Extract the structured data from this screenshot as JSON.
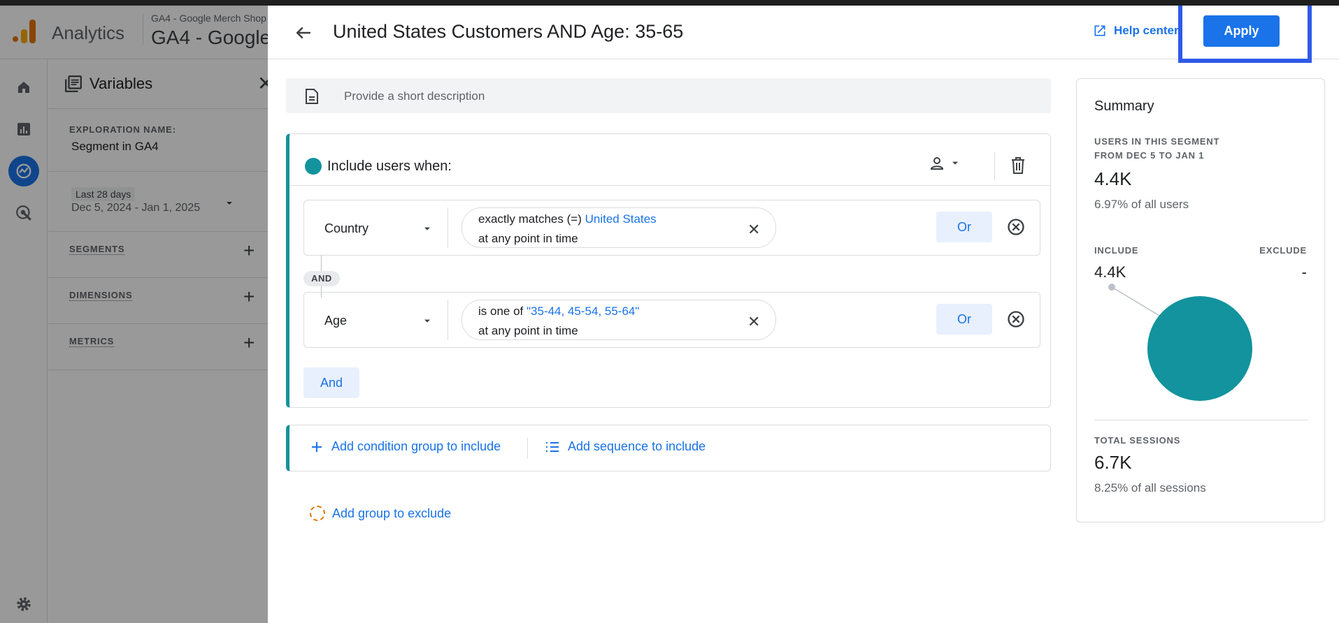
{
  "app": {
    "name": "Analytics",
    "property_small": "GA4 - Google Merch Shop",
    "property_big": "GA4 - Google"
  },
  "variables": {
    "title": "Variables",
    "exploration_label": "EXPLORATION NAME:",
    "exploration_value": "Segment in GA4",
    "date_chip": "Last 28 days",
    "date_range": "Dec 5, 2024 - Jan 1, 2025",
    "sections": [
      "SEGMENTS",
      "DIMENSIONS",
      "METRICS"
    ]
  },
  "editor": {
    "title": "United States Customers AND Age: 35-65",
    "help_label": "Help center",
    "apply_label": "Apply",
    "description_placeholder": "Provide a short description",
    "include_label": "Include users when:",
    "conditions": [
      {
        "dimension": "Country",
        "operator": "exactly matches (=)",
        "value": "United States",
        "time": "at any point in time",
        "or_label": "Or"
      },
      {
        "dimension": "Age",
        "operator": "is one of",
        "value": "\"35-44, 45-54, 55-64\"",
        "time": "at any point in time",
        "or_label": "Or"
      }
    ],
    "and_chip": "AND",
    "and_button": "And",
    "add_condition_group": "Add condition group to include",
    "add_sequence": "Add sequence to include",
    "add_exclude": "Add group to exclude"
  },
  "summary": {
    "title": "Summary",
    "users_label_1": "USERS IN THIS SEGMENT",
    "users_label_2": "FROM DEC 5 TO JAN 1",
    "users_value": "4.4K",
    "users_pct": "6.97% of all users",
    "include_label": "INCLUDE",
    "exclude_label": "EXCLUDE",
    "include_value": "4.4K",
    "exclude_value": "-",
    "sessions_label": "TOTAL SESSIONS",
    "sessions_value": "6.7K",
    "sessions_pct": "8.25% of all sessions"
  },
  "colors": {
    "accent": "#1a73e8",
    "segment_teal": "#12939e",
    "highlight": "#2f5ae8"
  },
  "icons": [
    "home-icon",
    "reports-icon",
    "explore-icon",
    "advertising-icon",
    "settings-icon",
    "back-arrow-icon",
    "open-in-new-icon",
    "description-icon",
    "person-scope-icon",
    "trash-icon",
    "remove-circle-icon",
    "plus-icon",
    "sequence-icon"
  ]
}
